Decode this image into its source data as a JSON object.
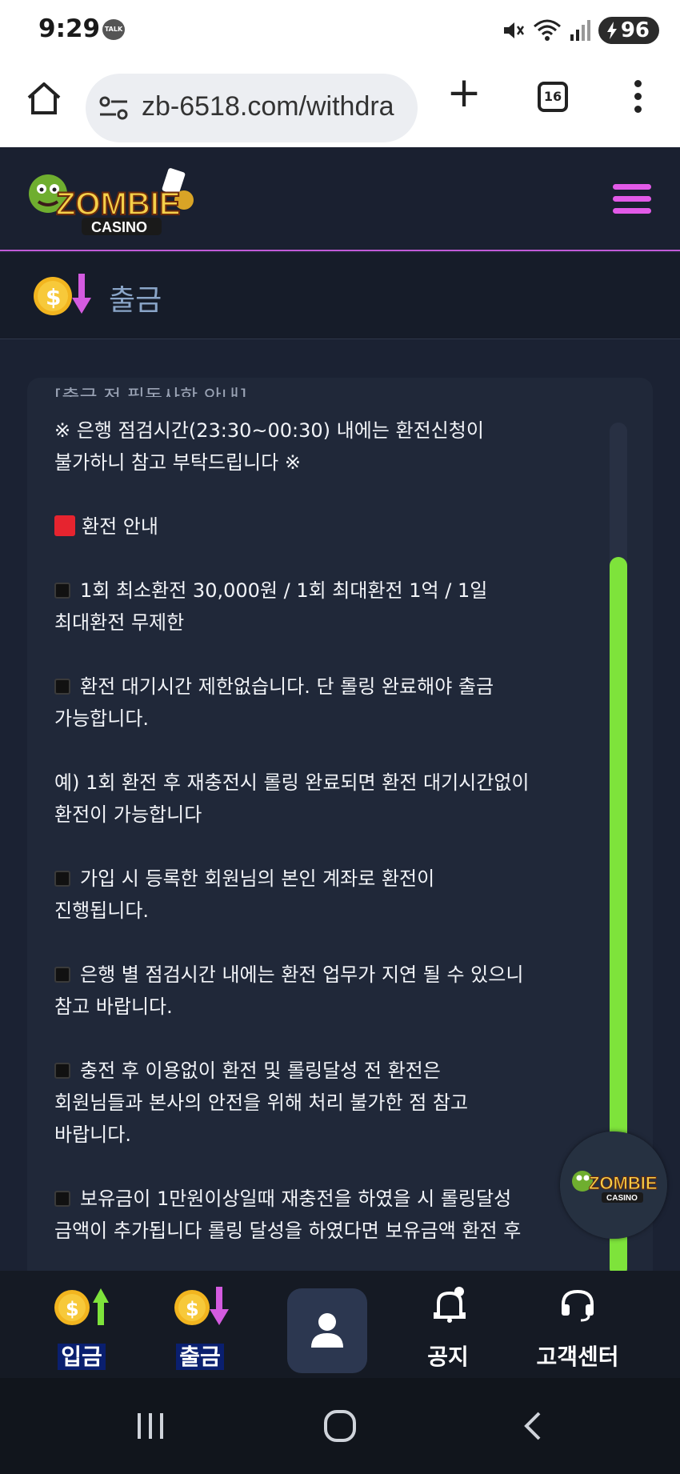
{
  "status_bar": {
    "time": "9:29",
    "talk_badge": "TALK",
    "battery": "96"
  },
  "browser": {
    "url": "zb-6518.com/withdra",
    "tab_count": "16"
  },
  "site": {
    "logo_text_top": "ZOMBIE",
    "logo_text_bottom": "CASINO",
    "accent_color": "#e25ae8"
  },
  "page": {
    "title": "출금"
  },
  "content": {
    "cut_line": "[출금 전 필독사항 안내]",
    "lines": [
      "※ 은행 점검시간(23:30~00:30) 내에는 환전신청이",
      "불가하니 참고 부탁드립니다 ※",
      "",
      "환전 안내",
      "",
      "1회 최소환전 30,000원 / 1회 최대환전 1억 / 1일",
      "최대환전 무제한",
      "",
      "환전 대기시간 제한없습니다. 단 롤링 완료해야 출금",
      "가능합니다.",
      "",
      "예) 1회 환전 후 재충전시 롤링 완료되면 환전 대기시간없이",
      "환전이 가능합니다",
      "",
      "가입 시 등록한 회원님의 본인 계좌로 환전이",
      "진행됩니다.",
      "",
      "은행 별 점검시간 내에는 환전 업무가 지연 될 수 있으니",
      "참고 바랍니다.",
      "",
      "충전 후 이용없이 환전 및 롤링달성 전 환전은",
      "회원님들과 본사의 안전을 위해 처리 불가한 점 참고",
      "바랍니다.",
      "",
      "보유금이 1만원이상일때 재충전을 하였을 시 롤링달성",
      "금액이 추가됩니다 롤링 달성을 하였다면 보유금액 환전 후"
    ]
  },
  "bottom_nav": {
    "deposit": "입금",
    "withdraw": "출금",
    "notice": "공지",
    "support": "고객센터"
  },
  "colors": {
    "scroll_thumb": "#7ee33b",
    "red_square": "#e6242f",
    "label_highlight": "#0a1f6f"
  }
}
